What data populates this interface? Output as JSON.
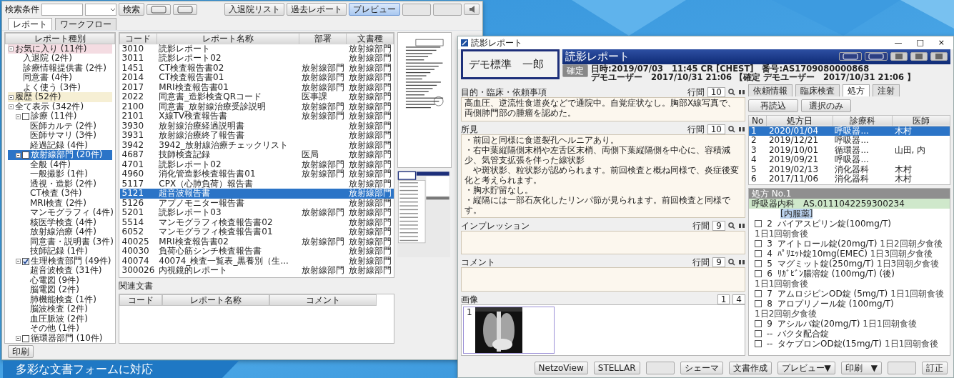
{
  "caption": "多彩な文書フォームに対応",
  "list_window": {
    "toolbar": {
      "search_label": "検索条件",
      "search_button": "検索",
      "buttons": [
        {
          "label": "入退院リスト",
          "pressed": false,
          "disabled": false
        },
        {
          "label": "過去レポート",
          "pressed": false,
          "disabled": false
        },
        {
          "label": "プレビュー",
          "pressed": true,
          "disabled": false
        },
        {
          "pressed": false,
          "disabled": true
        },
        {
          "pressed": false,
          "disabled": true
        }
      ]
    },
    "tabs": [
      {
        "label": "レポート",
        "selected": true
      },
      {
        "label": "ワークフロー",
        "selected": false
      }
    ],
    "tree": {
      "header": "レポート種別",
      "items": [
        {
          "label": "お気に入り (11件)",
          "kind": "favorite",
          "selected": false,
          "children": [
            {
              "label": "入退院 (2件)",
              "kind": "leaf",
              "selected": false
            },
            {
              "label": "診療情報提供書 (2件)",
              "kind": "leaf",
              "selected": false
            },
            {
              "label": "同意書 (4件)",
              "kind": "leaf",
              "selected": false
            },
            {
              "label": "よく使う (3件)",
              "kind": "leaf",
              "selected": false
            }
          ]
        },
        {
          "label": "履歴 (52件)",
          "kind": "history",
          "selected": false
        },
        {
          "label": "全て表示 (342件)",
          "kind": "folder",
          "selected": false,
          "children": [
            {
              "label": "診療 (11件)",
              "kind": "group",
              "checked": false,
              "selected": false,
              "children": [
                {
                  "label": "医師カルテ (2件)",
                  "kind": "leaf",
                  "selected": false
                },
                {
                  "label": "医師サマリ (3件)",
                  "kind": "leaf",
                  "selected": false
                },
                {
                  "label": "経過記録 (4件)",
                  "kind": "leaf",
                  "selected": false
                }
              ]
            },
            {
              "label": "放射線部門 (20件)",
              "kind": "group",
              "checked": false,
              "selected": true,
              "children": [
                {
                  "label": "全般 (4件)",
                  "kind": "leaf",
                  "selected": false
                },
                {
                  "label": "一般撮影 (1件)",
                  "kind": "leaf",
                  "selected": false
                },
                {
                  "label": "透視・造影 (2件)",
                  "kind": "leaf",
                  "selected": false
                },
                {
                  "label": "CT検査 (3件)",
                  "kind": "leaf",
                  "selected": false
                },
                {
                  "label": "MRI検査 (2件)",
                  "kind": "leaf",
                  "selected": false
                },
                {
                  "label": "マンモグラフィ (4件)",
                  "kind": "leaf",
                  "selected": false
                },
                {
                  "label": "核医学検査 (4件)",
                  "kind": "leaf",
                  "selected": false
                },
                {
                  "label": "放射線治療 (4件)",
                  "kind": "leaf",
                  "selected": false
                },
                {
                  "label": "同意書・説明書 (3件)",
                  "kind": "leaf",
                  "selected": false
                },
                {
                  "label": "技師記録 (1件)",
                  "kind": "leaf",
                  "selected": false
                }
              ]
            },
            {
              "label": "生理検査部門 (49件)",
              "kind": "group",
              "checked": true,
              "selected": false,
              "children": [
                {
                  "label": "超音波検査 (31件)",
                  "kind": "leaf",
                  "selected": false
                },
                {
                  "label": "心電図 (9件)",
                  "kind": "leaf",
                  "selected": false
                },
                {
                  "label": "脳電図 (2件)",
                  "kind": "leaf",
                  "selected": false
                },
                {
                  "label": "肺機能検査 (1件)",
                  "kind": "leaf",
                  "selected": false
                },
                {
                  "label": "脳波検査 (2件)",
                  "kind": "leaf",
                  "selected": false
                },
                {
                  "label": "血圧脈波 (2件)",
                  "kind": "leaf",
                  "selected": false
                },
                {
                  "label": "その他 (1件)",
                  "kind": "leaf",
                  "selected": false
                }
              ]
            },
            {
              "label": "循環器部門 (10件)",
              "kind": "group",
              "checked": false,
              "selected": false
            }
          ]
        }
      ]
    },
    "table": {
      "columns": [
        "コード",
        "レポート名称",
        "部署",
        "文書種"
      ],
      "rows": [
        {
          "cells": [
            "3010",
            "読影レポート",
            "",
            "放射線部門"
          ],
          "selected": false
        },
        {
          "cells": [
            "3011",
            "読影レポート02",
            "",
            "放射線部門"
          ],
          "selected": false
        },
        {
          "cells": [
            "1451",
            "CT検査報告書02",
            "放射線部門",
            "放射線部門"
          ],
          "selected": false
        },
        {
          "cells": [
            "2014",
            "CT検査報告書01",
            "放射線部門",
            "放射線部門"
          ],
          "selected": false
        },
        {
          "cells": [
            "2017",
            "MRI検査報告書01",
            "放射線部門",
            "放射線部門"
          ],
          "selected": false
        },
        {
          "cells": [
            "2022",
            "同意書_造影検査QRコード",
            "医事課",
            "放射線部門"
          ],
          "selected": false
        },
        {
          "cells": [
            "2100",
            "同意書_放射線治療受診説明",
            "放射線部門",
            "放射線部門"
          ],
          "selected": false
        },
        {
          "cells": [
            "2101",
            "X線TV検査報告書",
            "放射線部門",
            "放射線部門"
          ],
          "selected": false
        },
        {
          "cells": [
            "3930",
            "放射線治療経過説明書",
            "",
            "放射線部門"
          ],
          "selected": false
        },
        {
          "cells": [
            "3931",
            "放射線治療終了報告書",
            "",
            "放射線部門"
          ],
          "selected": false
        },
        {
          "cells": [
            "3942",
            "3942_放射線治療チェックリスト",
            "",
            "放射線部門"
          ],
          "selected": false
        },
        {
          "cells": [
            "4687",
            "技師検査記録",
            "医局",
            "放射線部門"
          ],
          "selected": false
        },
        {
          "cells": [
            "4701",
            "読影レポート02",
            "放射線部門",
            "放射線部門"
          ],
          "selected": false
        },
        {
          "cells": [
            "4960",
            "消化管造影検査報告書01",
            "放射線部門",
            "放射線部門"
          ],
          "selected": false
        },
        {
          "cells": [
            "5117",
            "CPX（心肺負荷）報告書",
            "",
            "放射線部門"
          ],
          "selected": false
        },
        {
          "cells": [
            "5121",
            "超音波報告書",
            "",
            "放射線部門"
          ],
          "selected": true
        },
        {
          "cells": [
            "5126",
            "アプノモニター報告書",
            "",
            "放射線部門"
          ],
          "selected": false
        },
        {
          "cells": [
            "5201",
            "読影レポート03",
            "放射線部門",
            "放射線部門"
          ],
          "selected": false
        },
        {
          "cells": [
            "5514",
            "マンモグラフィ検査報告書02",
            "",
            "放射線部門"
          ],
          "selected": false
        },
        {
          "cells": [
            "6052",
            "マンモグラフィ検査報告書01",
            "",
            "放射線部門"
          ],
          "selected": false
        },
        {
          "cells": [
            "40025",
            "MRI検査報告書02",
            "放射線部門",
            "放射線部門"
          ],
          "selected": false
        },
        {
          "cells": [
            "40030",
            "負荷心筋シンチ検査報告書",
            "",
            "放射線部門"
          ],
          "selected": false
        },
        {
          "cells": [
            "40074",
            "40074_検査一覧表_黒養別（生...",
            "",
            "放射線部門"
          ],
          "selected": false
        },
        {
          "cells": [
            "300026",
            "内視鏡的レポート",
            "放射線部門",
            "放射線部門"
          ],
          "selected": false
        }
      ]
    },
    "related": {
      "label": "関連文書",
      "columns": [
        "コード",
        "レポート名称",
        "コメント"
      ]
    },
    "print_button": "印刷"
  },
  "report_window": {
    "title": "読影レポート",
    "window_controls": [
      "—",
      "□",
      "×"
    ],
    "patient_name": "デモ標準　一郎",
    "status_button": "確定",
    "heading": "読影レポート",
    "info_lines": [
      "日時:2019/07/03　11:45 CR [CHEST]　番号:AS1709080000868",
      "デモユーザー　2017/10/31 21:06 【確定 デモユーザー　2017/10/31 21:06 】"
    ],
    "sections": [
      {
        "label": "目的・臨床・依頼事項",
        "spacing_label": "行間",
        "font_size": "10",
        "lines": [
          "高血圧、逆流性食道炎などで通院中。自覚症状なし。胸部X線写真で、両側肺門部の腫瘤を認めた。"
        ]
      },
      {
        "label": "所見",
        "spacing_label": "行間",
        "font_size": "10",
        "lines": [
          "・前回と同様に食道裂孔ヘルニアあり。",
          "・右中葉縦隔側末梢や左舌区末梢、両側下葉縦隔側を中心に、容積減少、気管支拡張を伴った線状影",
          "　や斑状影、粒状影が認められます。前回検査と概ね同様で、炎症後変化と考えられます。",
          "・胸水貯留なし。",
          "・縦隔には一部石灰化したリンパ節が見られます。前回検査と同様です。"
        ]
      },
      {
        "label": "インプレッション",
        "spacing_label": "行間",
        "font_size": "9"
      },
      {
        "label": "コメント",
        "spacing_label": "行間",
        "font_size": "9"
      }
    ],
    "images": {
      "label": "画像",
      "thumbnails": [
        {
          "number": "1",
          "selected": true,
          "kind": "picture"
        }
      ],
      "page": "1",
      "pages": "4"
    },
    "buttons": [
      {
        "label": "NetzoView",
        "disabled": false
      },
      {
        "label": "STELLAR",
        "disabled": false
      },
      {
        "disabled": true
      },
      {
        "label": "シェーマ",
        "disabled": false
      },
      {
        "label": "文書作成",
        "disabled": false
      },
      {
        "label": "プレビュー▼",
        "disabled": false
      },
      {
        "label": "印刷　▼",
        "disabled": false
      },
      {
        "disabled": true
      },
      {
        "label": "訂正",
        "disabled": false
      }
    ],
    "side_tabs": [
      {
        "label": "依頼情報",
        "selected": false
      },
      {
        "label": "臨床検査",
        "selected": false
      },
      {
        "label": "処方",
        "selected": true
      },
      {
        "label": "注射",
        "selected": false
      }
    ],
    "side_buttons": [
      "再読込",
      "選択のみ"
    ],
    "prescriptions": {
      "columns": [
        "No",
        "処方日",
        "診療科",
        "医師"
      ],
      "rows": [
        {
          "cells": [
            "1",
            "2020/01/04",
            "呼吸器...",
            "木村"
          ],
          "selected": true
        },
        {
          "cells": [
            "2",
            "2019/12/21",
            "呼吸器...",
            ""
          ],
          "selected": false
        },
        {
          "cells": [
            "3",
            "2019/10/01",
            "循環器...",
            "山田, 内"
          ],
          "selected": false
        },
        {
          "cells": [
            "4",
            "2019/09/21",
            "呼吸器...",
            ""
          ],
          "selected": false
        },
        {
          "cells": [
            "5",
            "2019/02/13",
            "消化器科",
            "木村"
          ],
          "selected": false
        },
        {
          "cells": [
            "6",
            "2017/11/06",
            "消化器科",
            "木村"
          ],
          "selected": false
        }
      ]
    },
    "detail": {
      "title": "処方 No.1",
      "department": "呼吸器内科　AS.0111042259300234",
      "group": "[内服薬]",
      "drugs": [
        {
          "number": "2",
          "name": "バイアスピリン錠(100mg/T)",
          "usage": "1日1回朝食後",
          "checked": false
        },
        {
          "number": "3",
          "name": "アイトロール錠(20mg/T)",
          "usage": "1日2回朝夕食後",
          "checked": false
        },
        {
          "number": "4",
          "name": "ﾊﾟﾘｴｯﾄ錠10mg(EMEC)",
          "usage": "1日3回朝夕食後",
          "checked": false
        },
        {
          "number": "5",
          "name": "マグミット錠(250mg/T)",
          "usage": "1日3回朝夕食後",
          "checked": false
        },
        {
          "number": "6",
          "name": "ﾘｶﾞﾋﾞﾝ腸溶錠 (100mg/T) (後)",
          "usage": "1日1回朝食後",
          "checked": false
        },
        {
          "number": "7",
          "name": "アムロジピンOD錠 (5mg/T)",
          "usage": "1日1回朝食後",
          "checked": false
        },
        {
          "number": "8",
          "name": "アロプリノール錠 (100mg/T)",
          "usage": "1日2回朝夕食後",
          "checked": false
        },
        {
          "number": "9",
          "name": "アシルバ錠(20mg/T)",
          "usage": "1日1回朝食後",
          "checked": false
        },
        {
          "number": "--",
          "name": "バクタ配合錠",
          "checked": false
        },
        {
          "number": "--",
          "name": "タケプロンOD錠(15mg/T)",
          "usage": "1日1回朝食後",
          "checked": false
        }
      ]
    }
  }
}
